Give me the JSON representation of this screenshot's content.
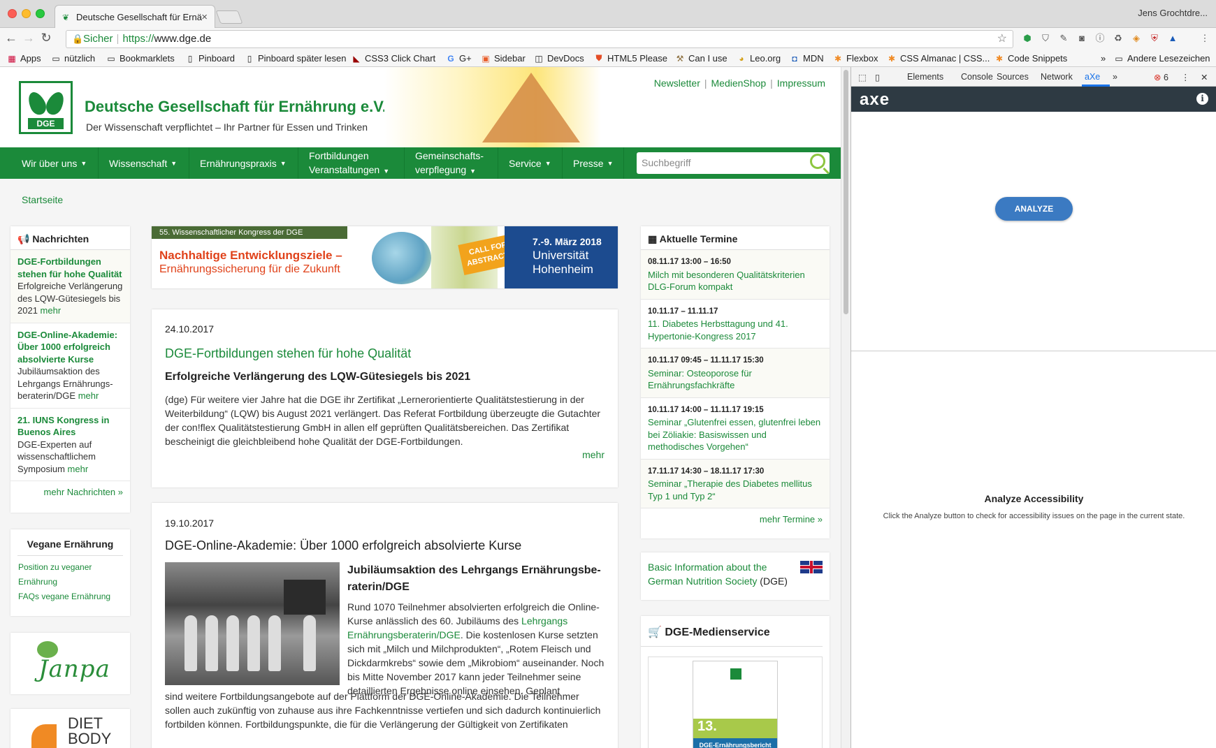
{
  "window": {
    "tab_title": "Deutsche Gesellschaft für Ernä",
    "user": "Jens Grochtdre..."
  },
  "toolbar": {
    "secure_label": "Sicher",
    "url_proto": "https://",
    "url_host": "www.dge.de"
  },
  "bookmarks": [
    {
      "label": "Apps",
      "icon": "apps-grid-icon"
    },
    {
      "label": "nützlich",
      "icon": "folder-icon"
    },
    {
      "label": "Bookmarklets",
      "icon": "folder-icon"
    },
    {
      "label": "Pinboard",
      "icon": "page-icon"
    },
    {
      "label": "Pinboard später lesen",
      "icon": "page-icon"
    },
    {
      "label": "CSS3 Click Chart",
      "icon": "cursor-icon"
    },
    {
      "label": "G+",
      "icon": "google-icon"
    },
    {
      "label": "Sidebar",
      "icon": "sidebar-icon"
    },
    {
      "label": "DevDocs",
      "icon": "devdocs-icon"
    },
    {
      "label": "HTML5 Please",
      "icon": "html5-icon"
    },
    {
      "label": "Can I use",
      "icon": "caniuse-icon"
    },
    {
      "label": "Leo.org",
      "icon": "leo-icon"
    },
    {
      "label": "MDN",
      "icon": "mdn-icon"
    },
    {
      "label": "Flexbox",
      "icon": "asterisk-icon"
    },
    {
      "label": "CSS Almanac | CSS...",
      "icon": "asterisk-icon"
    },
    {
      "label": "Code Snippets",
      "icon": "asterisk-icon"
    }
  ],
  "bookmarks_overflow": "»",
  "bookmarks_other": "Andere Lesezeichen",
  "site": {
    "title": "Deutsche Gesellschaft für Ernährung e.V.",
    "subtitle": "Der Wissenschaft verpflichtet – Ihr Partner für Essen und Trinken",
    "logo_text": "DGE",
    "top_links": [
      "Newsletter",
      "MedienShop",
      "Impressum"
    ],
    "nav": [
      {
        "line1": "Wir über uns",
        "line2": ""
      },
      {
        "line1": "Wissenschaft",
        "line2": ""
      },
      {
        "line1": "Ernährungspraxis",
        "line2": ""
      },
      {
        "line1": "Fortbildungen",
        "line2": "Veranstaltungen"
      },
      {
        "line1": "Gemeinschafts-",
        "line2": "verpflegung"
      },
      {
        "line1": "Service",
        "line2": ""
      },
      {
        "line1": "Presse",
        "line2": ""
      }
    ],
    "search_placeholder": "Suchbegriff",
    "breadcrumb": "Startseite"
  },
  "news": {
    "heading": "Nachrichten",
    "items": [
      {
        "title": "DGE-Fortbildungen stehen für hohe Qualität",
        "text": "Erfolgreiche Verlängerung des LQW-Gütesiegels bis 2021",
        "more": "mehr"
      },
      {
        "title": "DGE-Online-Akademie: Über 1000 erfolgreich absolvierte Kurse",
        "text": "Jubiläumsaktion des Lehrgangs Ernährungs-beraterin/DGE",
        "more": "mehr"
      },
      {
        "title": "21. IUNS Kongress in Buenos Aires",
        "text": "DGE-Experten auf wissenschaftlichem Symposium",
        "more": "mehr"
      }
    ],
    "more_all": "mehr Nachrichten »"
  },
  "vegan": {
    "heading": "Vegane Ernährung",
    "links": [
      "Position zu veganer Ernährung",
      "FAQs vegane Ernährung"
    ]
  },
  "partners": {
    "janpa": "Janpa",
    "diet": "DIET BODY"
  },
  "banner": {
    "tag": "55. Wissenschaftlicher Kongress der DGE",
    "headline": "Nachhaltige Entwicklungsziele –",
    "subline": "Ernährungssicherung für die Zukunft",
    "cfa_line1": "CALL FOR",
    "cfa_line2": "ABSTRACTS",
    "date": "7.-9. März 2018",
    "place1": "Universität",
    "place2": "Hohenheim"
  },
  "articles": [
    {
      "date": "24.10.2017",
      "title": "DGE-Fortbildungen stehen für hohe Qualität",
      "subtitle": "Erfolgreiche Verlängerung des LQW-Gütesiegels bis 2021",
      "body": "(dge) Für weitere vier Jahre hat die DGE ihr Zertifikat „Lernerorientierte Qualitätstestierung in der Weiterbildung“ (LQW) bis August 2021 verlängert. Das Referat Fortbildung überzeugte die Gutachter der con!flex Qualitätstestierung GmbH in allen elf geprüften Qualitätsbereichen. Das Zertifikat bescheinigt die gleichbleibend hohe Qualität der DGE-Fortbildungen.",
      "more": "mehr"
    },
    {
      "date": "19.10.2017",
      "title": "DGE-Online-Akademie: Über 1000 erfolgreich absolvierte Kurse",
      "subtitle": "Jubiläumsaktion des Lehrgangs Ernährungsbe-raterin/DGE",
      "body_pre": "Rund 1070 Teilnehmer absolvierten erfolgreich die Online-Kurse anlässlich des 60. Jubiläums des ",
      "body_link": "Lehrgangs Ernährungsberaterin/DGE",
      "body_post": ". Die kostenlosen Kurse setzten sich mit „Milch und Milchprodukten“, „Rotem Fleisch und Dickdarmkrebs“ sowie dem „Mikrobiom“ auseinander. Noch bis Mitte November 2017 kann jeder Teilnehmer seine detaillierten Ergebnisse online einsehen. Geplant",
      "body_cont": "sind weitere Fortbildungsangebote auf der Plattform der DGE-Online-Akademie. Die Teilnehmer sollen auch zukünftig von zuhause aus ihre Fachkenntnisse vertiefen und sich dadurch kontinuierlich fortbilden können. Fortbildungspunkte, die für die Verlängerung der Gültigkeit von Zertifikaten"
    }
  ],
  "events": {
    "heading": "Aktuelle Termine",
    "items": [
      {
        "date": "08.11.17 13:00 – 16:50",
        "title": "Milch mit besonderen Qualitätskriterien DLG-Forum kompakt"
      },
      {
        "date": "10.11.17 – 11.11.17",
        "title": "11. Diabetes Herbsttagung und 41. Hypertonie-Kongress 2017"
      },
      {
        "date": "10.11.17 09:45 – 11.11.17 15:30",
        "title": "Seminar: Osteoporose für Ernährungsfachkräfte"
      },
      {
        "date": "10.11.17 14:00 – 11.11.17 19:15",
        "title": "Seminar „Glutenfrei essen, glutenfrei leben bei Zöliakie: Basiswissen und methodisches Vorgehen“"
      },
      {
        "date": "17.11.17 14:30 – 18.11.17 17:30",
        "title": "Seminar „Therapie des Diabetes mellitus Typ 1 und Typ 2“"
      }
    ],
    "more": "mehr Termine »"
  },
  "english": {
    "link": "Basic Information about the German Nutrition Society",
    "suffix": " (DGE)"
  },
  "media": {
    "heading": "DGE-Medienservice",
    "book_num": "13.",
    "book_title": "DGE-Ernährungsbericht"
  },
  "devtools": {
    "tabs": [
      "Elements",
      "Console",
      "Sources",
      "Network",
      "aXe"
    ],
    "more_tabs": "»",
    "error_count": "6",
    "axe_logo": "axe",
    "analyze": "ANALYZE",
    "empty_title": "Analyze Accessibility",
    "empty_desc": "Click the Analyze button to check for accessibility issues on the page in the current state."
  },
  "colors": {
    "brand_green": "#1b8a3a",
    "banner_orange": "#e0421a",
    "axe_blue": "#3b7ac2",
    "axe_dark": "#2e3a43"
  }
}
